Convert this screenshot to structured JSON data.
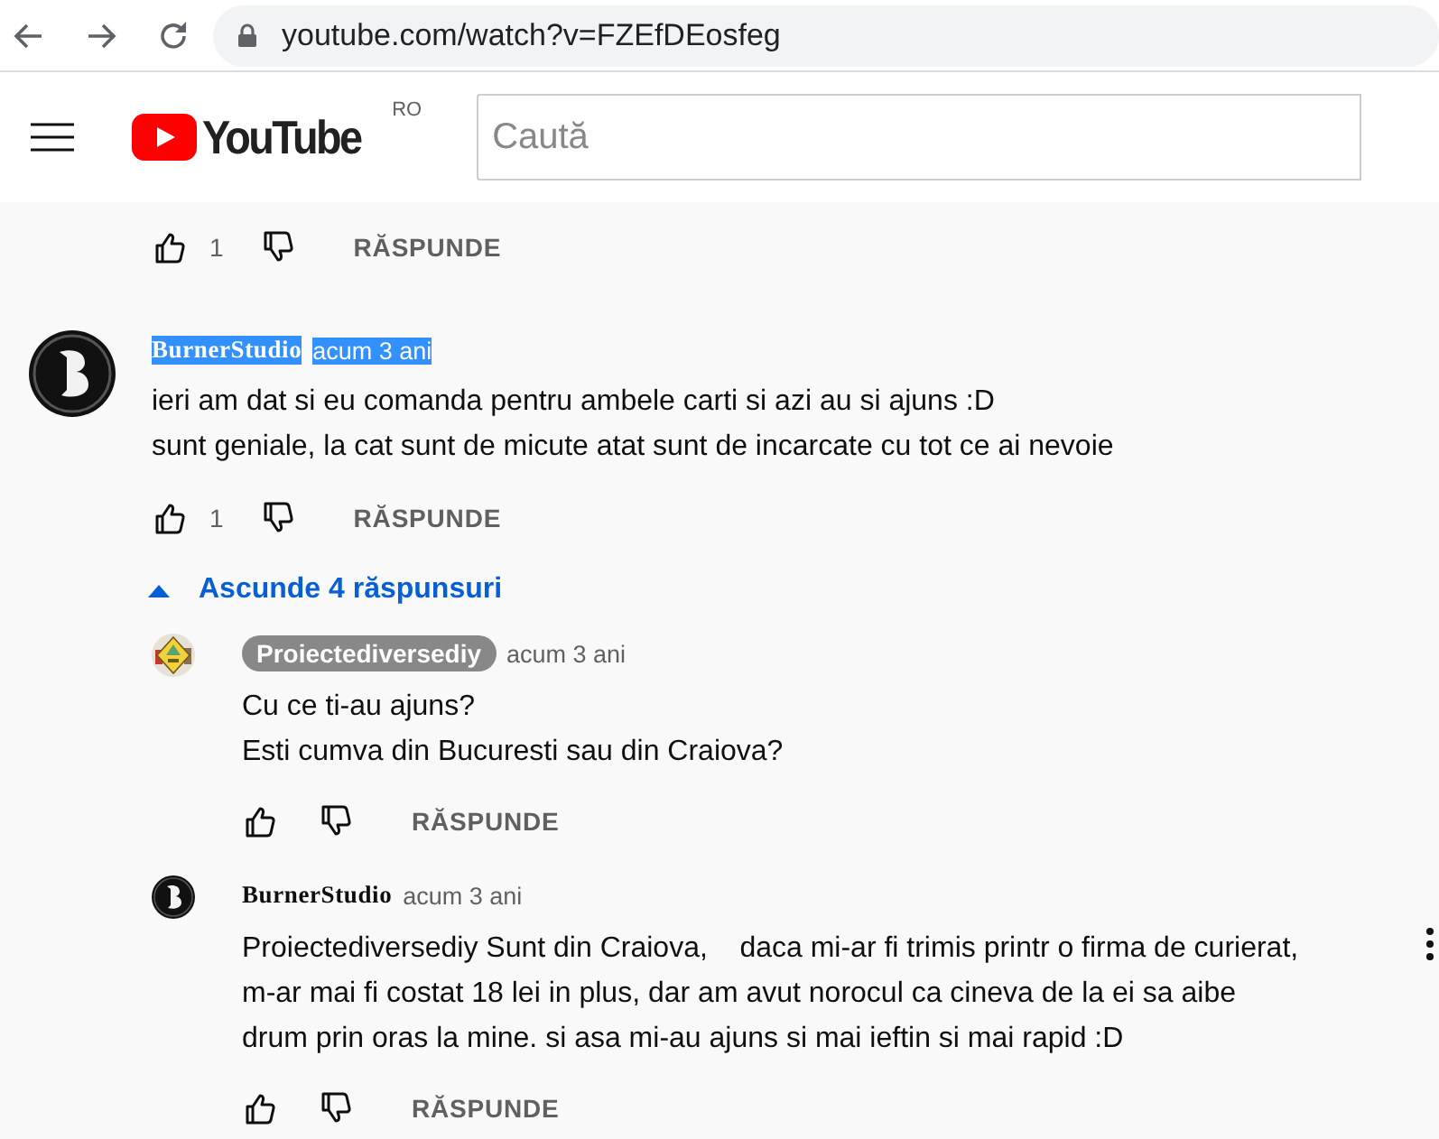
{
  "browser": {
    "url": "youtube.com/watch?v=FZEfDEosfeg"
  },
  "header": {
    "logo_text": "YouTube",
    "region": "RO",
    "search": {
      "placeholder": "Caută"
    }
  },
  "previous_comment_actions": {
    "likes": "1",
    "reply": "RĂSPUNDE"
  },
  "comments": [
    {
      "author": "BurnerStudio",
      "author_badge": false,
      "highlighted": true,
      "time": "acum 3 ani",
      "text": "ieri am dat si eu comanda pentru ambele carti si azi au si ajuns :D\nsunt geniale, la cat sunt de micute atat sunt de incarcate cu tot ce ai nevoie",
      "likes": "1",
      "reply": "RĂSPUNDE",
      "menu": false,
      "replies_toggle": {
        "label": "Ascunde 4 răspunsuri",
        "expanded": true
      },
      "replies": [
        {
          "author": "Proiectediversediy",
          "author_badge": true,
          "highlighted": false,
          "time": "acum 3 ani",
          "text": "Cu ce ti-au ajuns?\nEsti cumva din Bucuresti sau din Craiova?",
          "reply": "RĂSPUNDE",
          "menu": false
        },
        {
          "author": "BurnerStudio",
          "author_badge": false,
          "highlighted": false,
          "time": "acum 3 ani",
          "text": "Proiectediversediy Sunt din Craiova,    daca mi-ar fi trimis printr o firma de curierat, m-ar mai fi costat 18 lei in plus, dar am avut norocul ca cineva de la ei sa aibe drum prin oras la mine. si asa mi-au ajuns si mai ieftin si mai rapid :D",
          "reply": "RĂSPUNDE",
          "menu": true
        }
      ]
    }
  ]
}
